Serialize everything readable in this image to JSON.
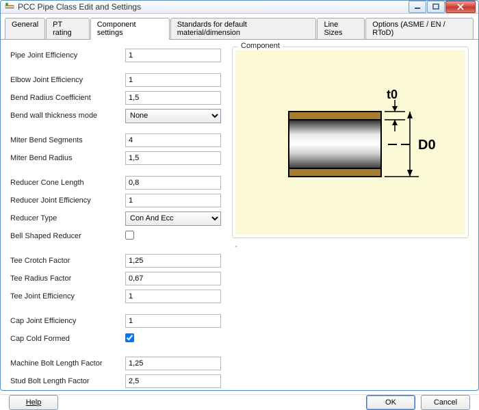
{
  "window": {
    "title": "PCC Pipe Class Edit and Settings"
  },
  "tabs": [
    {
      "label": "General"
    },
    {
      "label": "PT rating"
    },
    {
      "label": "Component settings"
    },
    {
      "label": "Standards for default material/dimension"
    },
    {
      "label": "Line Sizes"
    },
    {
      "label": "Options (ASME / EN / RToD)"
    }
  ],
  "fields": {
    "pipe_joint_eff": {
      "label": "Pipe Joint Efficiency",
      "value": "1"
    },
    "elbow_joint_eff": {
      "label": "Elbow Joint Efficiency",
      "value": "1"
    },
    "bend_radius_coef": {
      "label": "Bend Radius Coefficient",
      "value": "1,5"
    },
    "bend_wall_mode": {
      "label": "Bend wall thickness mode",
      "value": "None"
    },
    "miter_segments": {
      "label": "Miter Bend Segments",
      "value": "4"
    },
    "miter_radius": {
      "label": "Miter Bend Radius",
      "value": "1,5"
    },
    "red_cone_len": {
      "label": "Reducer Cone Length",
      "value": "0,8"
    },
    "red_joint_eff": {
      "label": "Reducer Joint Efficiency",
      "value": "1"
    },
    "red_type": {
      "label": "Reducer Type",
      "value": "Con And Ecc"
    },
    "bell_reducer": {
      "label": "Bell Shaped Reducer",
      "checked": false
    },
    "tee_crotch": {
      "label": "Tee Crotch Factor",
      "value": "1,25"
    },
    "tee_radius": {
      "label": "Tee Radius Factor",
      "value": "0,67"
    },
    "tee_joint_eff": {
      "label": "Tee Joint Efficiency",
      "value": "1"
    },
    "cap_joint_eff": {
      "label": "Cap Joint Efficiency",
      "value": "1"
    },
    "cap_cold_formed": {
      "label": "Cap Cold Formed",
      "checked": true
    },
    "mach_bolt_len": {
      "label": "Machine Bolt Length Factor",
      "value": "1,25"
    },
    "stud_bolt_len": {
      "label": "Stud Bolt Length Factor",
      "value": "2,5"
    }
  },
  "preview": {
    "title": "Component",
    "labels": {
      "t0": "t0",
      "d0": "D0"
    }
  },
  "buttons": {
    "help": "Help",
    "ok": "OK",
    "cancel": "Cancel"
  }
}
